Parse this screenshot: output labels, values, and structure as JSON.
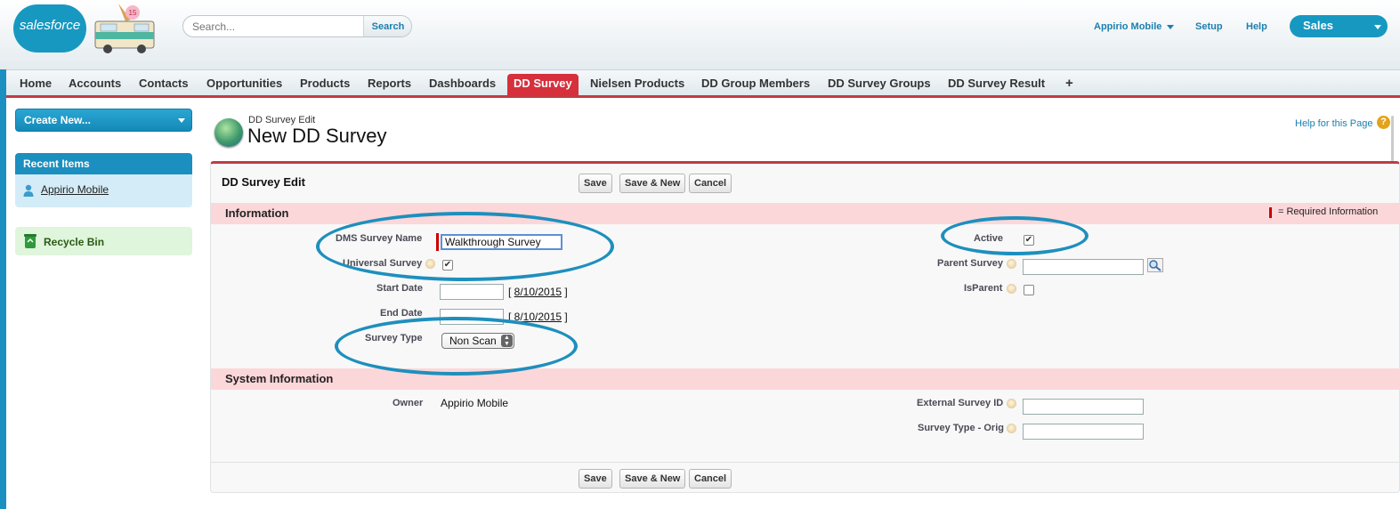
{
  "header": {
    "logo_text": "salesforce",
    "truck_badge": "15",
    "search_placeholder": "Search...",
    "search_button": "Search",
    "user_menu": "Appirio Mobile",
    "setup": "Setup",
    "help": "Help",
    "app_menu": "Sales"
  },
  "tabs": [
    {
      "label": "Home",
      "active": false
    },
    {
      "label": "Accounts",
      "active": false
    },
    {
      "label": "Contacts",
      "active": false
    },
    {
      "label": "Opportunities",
      "active": false
    },
    {
      "label": "Products",
      "active": false
    },
    {
      "label": "Reports",
      "active": false
    },
    {
      "label": "Dashboards",
      "active": false
    },
    {
      "label": "DD Survey",
      "active": true
    },
    {
      "label": "Nielsen Products",
      "active": false
    },
    {
      "label": "DD Group Members",
      "active": false
    },
    {
      "label": "DD Survey Groups",
      "active": false
    },
    {
      "label": "DD Survey Result",
      "active": false
    },
    {
      "label": "+",
      "active": false
    }
  ],
  "sidebar": {
    "create_new": "Create New...",
    "recent_title": "Recent Items",
    "recent_items": [
      "Appirio Mobile"
    ],
    "recycle_bin": "Recycle Bin"
  },
  "page": {
    "subtitle": "DD Survey Edit",
    "title": "New DD Survey",
    "help_link": "Help for this Page",
    "help_icon": "?"
  },
  "panel": {
    "title": "DD Survey Edit",
    "buttons": {
      "save": "Save",
      "save_new": "Save & New",
      "cancel": "Cancel"
    },
    "required_info": "= Required Information"
  },
  "information": {
    "section_title": "Information",
    "dms_survey_name": {
      "label": "DMS Survey Name",
      "value": "Walkthrough Survey"
    },
    "universal_survey": {
      "label": "Universal Survey",
      "checked": true
    },
    "start_date": {
      "label": "Start Date",
      "value": "",
      "today_link": "8/10/2015"
    },
    "end_date": {
      "label": "End Date",
      "value": "",
      "today_link": "8/10/2015"
    },
    "survey_type": {
      "label": "Survey Type",
      "value": "Non Scan"
    },
    "active": {
      "label": "Active",
      "checked": true
    },
    "parent_survey": {
      "label": "Parent Survey",
      "value": ""
    },
    "is_parent": {
      "label": "IsParent",
      "checked": false
    }
  },
  "system_information": {
    "section_title": "System Information",
    "owner": {
      "label": "Owner",
      "value": "Appirio Mobile"
    },
    "external_survey_id": {
      "label": "External Survey ID",
      "value": ""
    },
    "survey_type_orig": {
      "label": "Survey Type - Orig",
      "value": ""
    }
  },
  "colors": {
    "brand_blue": "#1798c1",
    "active_tab_red": "#d6303c",
    "section_pink": "#fcd7d9",
    "highlight_oval": "#1e8fbd"
  }
}
